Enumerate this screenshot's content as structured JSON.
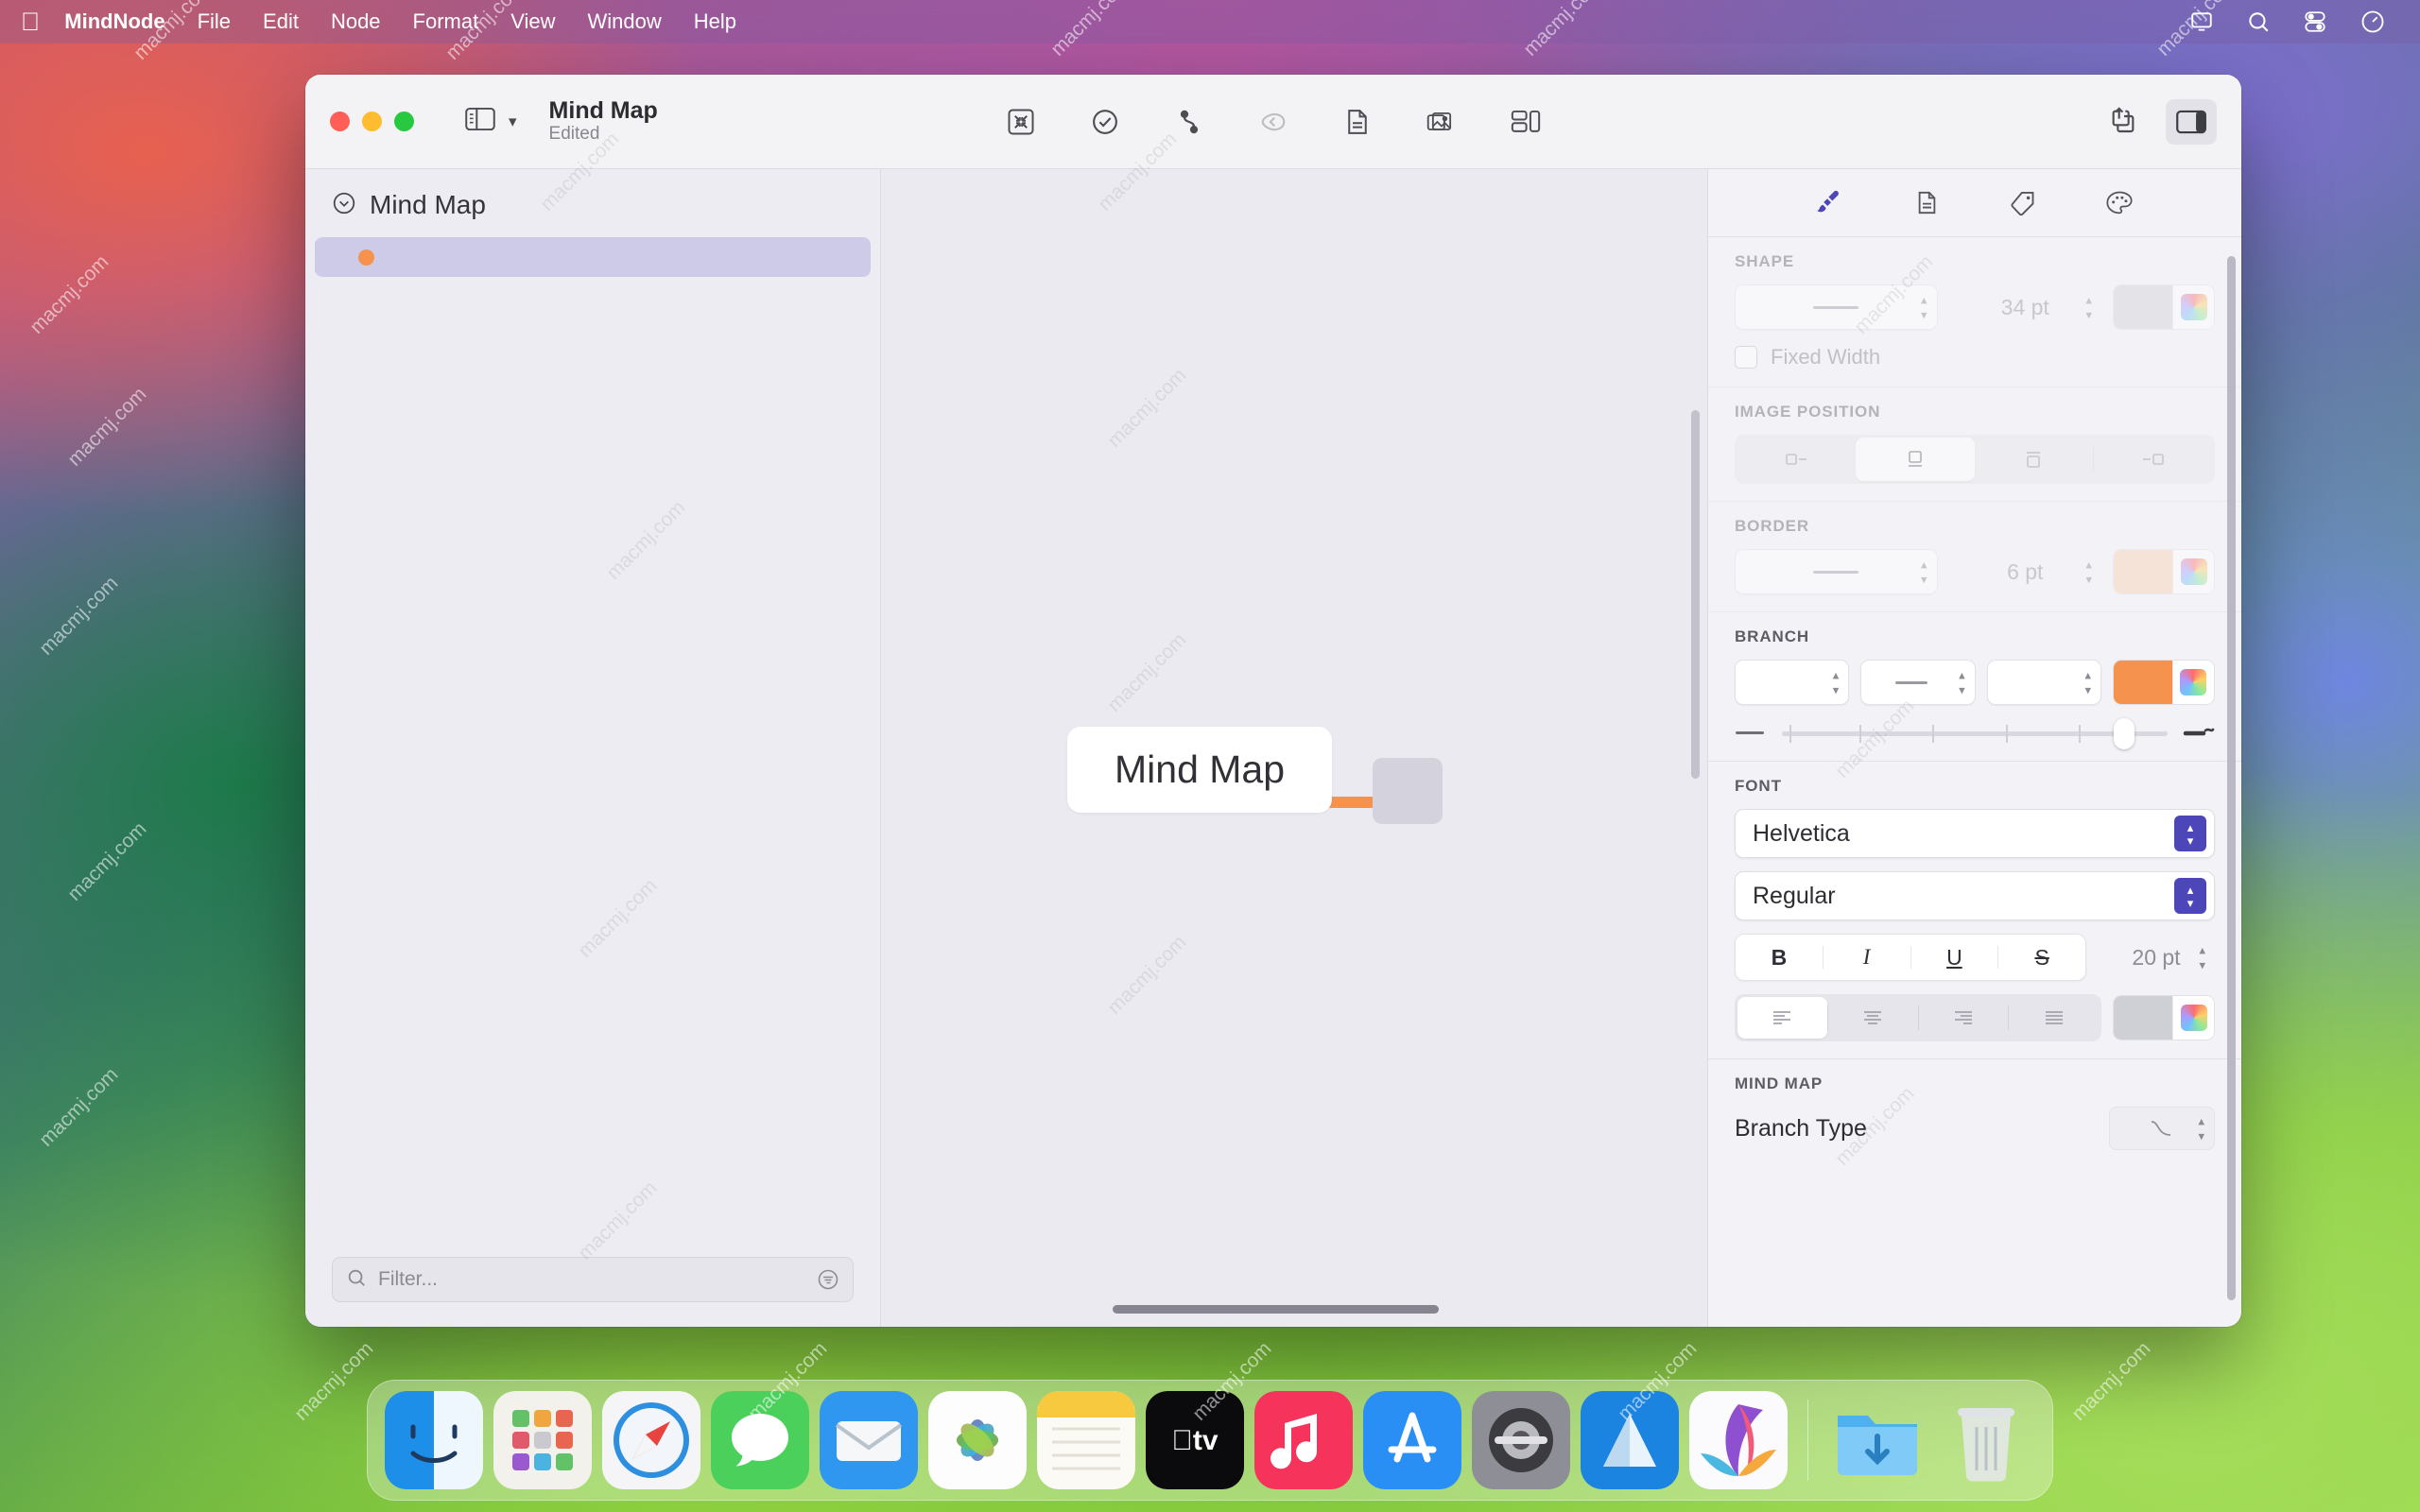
{
  "menubar": {
    "apple_icon": "apple-logo-icon",
    "items": [
      {
        "label": "MindNode",
        "bold": true
      },
      {
        "label": "File",
        "bold": false
      },
      {
        "label": "Edit",
        "bold": false
      },
      {
        "label": "Node",
        "bold": false
      },
      {
        "label": "Format",
        "bold": false
      },
      {
        "label": "View",
        "bold": false
      },
      {
        "label": "Window",
        "bold": false
      },
      {
        "label": "Help",
        "bold": false
      }
    ],
    "status_icons": [
      "screen-mirroring-icon",
      "search-icon",
      "control-center-icon",
      "siri-icon"
    ]
  },
  "window": {
    "traffic_lights": [
      "close-button",
      "minimize-button",
      "zoom-button"
    ],
    "sidebar_toggle_icon": "sidebar-toggle-icon",
    "chevron_icon": "chevron-down-icon",
    "title": "Mind Map",
    "subtitle": "Edited",
    "toolbar_center": [
      {
        "name": "focus-icon",
        "dim": false
      },
      {
        "name": "task-checkmark-icon",
        "dim": false
      },
      {
        "name": "connection-icon",
        "dim": false
      },
      {
        "name": "outline-back-icon",
        "dim": true
      },
      {
        "name": "note-icon",
        "dim": false
      },
      {
        "name": "images-icon",
        "dim": false
      },
      {
        "name": "layout-icon",
        "dim": false
      }
    ],
    "toolbar_right": [
      {
        "name": "share-icon",
        "active": false
      },
      {
        "name": "inspector-toggle-icon",
        "active": true
      }
    ]
  },
  "sidebar": {
    "header_icon": "chevron-down-circle-icon",
    "header_label": "Mind Map",
    "rows": [
      {
        "bullet_color": "#f5934e",
        "label": "",
        "selected": true
      }
    ],
    "filter": {
      "search_icon": "search-icon",
      "placeholder": "Filter...",
      "options_icon": "filter-options-icon",
      "value": ""
    }
  },
  "canvas": {
    "root_node_label": "Mind Map",
    "branch_color": "#f5934e",
    "child_node_label": "",
    "scrollbars": [
      "vertical-scrollbar",
      "horizontal-scrollbar"
    ]
  },
  "inspector": {
    "tabs": [
      {
        "name": "style-tab",
        "icon": "paintbrush-icon",
        "active": true
      },
      {
        "name": "document-tab",
        "icon": "document-icon",
        "active": false
      },
      {
        "name": "tags-tab",
        "icon": "tag-icon",
        "active": false
      },
      {
        "name": "theme-tab",
        "icon": "palette-icon",
        "active": false
      }
    ],
    "shape": {
      "title": "SHAPE",
      "style_value": "—",
      "size_value": "34 pt",
      "swatch_color": "#cfcfd6",
      "fixed_width_label": "Fixed Width",
      "fixed_width_checked": false
    },
    "image_position": {
      "title": "IMAGE POSITION",
      "options": [
        {
          "name": "image-position-left",
          "selected": false
        },
        {
          "name": "image-position-bottom",
          "selected": true
        },
        {
          "name": "image-position-top",
          "selected": false
        },
        {
          "name": "image-position-right",
          "selected": false
        }
      ]
    },
    "border": {
      "title": "BORDER",
      "style_value": "—",
      "size_value": "6 pt",
      "swatch_color": "#fbd0b0"
    },
    "branch": {
      "title": "BRANCH",
      "field1_value": "",
      "field2_value": "—",
      "field3_value": "",
      "swatch_color": "#f5934e",
      "slider_percent": 88,
      "slider_left_icon": "thin-line-icon",
      "slider_right_icon": "thick-line-icon"
    },
    "font": {
      "title": "FONT",
      "family": "Helvetica",
      "style": "Regular",
      "bold_label": "B",
      "italic_label": "I",
      "underline_label": "U",
      "strike_label": "S",
      "size_value": "20 pt",
      "align_options": [
        {
          "name": "align-left",
          "selected": true
        },
        {
          "name": "align-center",
          "selected": false
        },
        {
          "name": "align-right",
          "selected": false
        },
        {
          "name": "align-justify",
          "selected": false
        }
      ],
      "color_swatch": "#cfcfd6"
    },
    "mind_map": {
      "title": "MIND MAP",
      "branch_type_label": "Branch Type",
      "branch_type_icon": "curve-branch-icon"
    }
  },
  "dock": {
    "items": [
      {
        "name": "dock-finder",
        "label": "Finder",
        "running": true
      },
      {
        "name": "dock-launchpad",
        "label": "Launchpad",
        "running": false
      },
      {
        "name": "dock-safari",
        "label": "Safari",
        "running": false
      },
      {
        "name": "dock-messages",
        "label": "Messages",
        "running": false
      },
      {
        "name": "dock-mail",
        "label": "Mail",
        "running": false
      },
      {
        "name": "dock-photos",
        "label": "Photos",
        "running": false
      },
      {
        "name": "dock-notes",
        "label": "Notes",
        "running": false
      },
      {
        "name": "dock-appletv",
        "label": "Apple TV",
        "running": false
      },
      {
        "name": "dock-music",
        "label": "Music",
        "running": false
      },
      {
        "name": "dock-appstore",
        "label": "App Store",
        "running": false
      },
      {
        "name": "dock-settings",
        "label": "System Settings",
        "running": false
      },
      {
        "name": "dock-xcode",
        "label": "Xcode",
        "running": false
      },
      {
        "name": "dock-mindnode",
        "label": "MindNode",
        "running": true
      }
    ],
    "trailing": [
      {
        "name": "dock-downloads",
        "label": "Downloads"
      },
      {
        "name": "dock-trash",
        "label": "Trash"
      }
    ]
  },
  "watermarks": [
    "macmj.com"
  ]
}
